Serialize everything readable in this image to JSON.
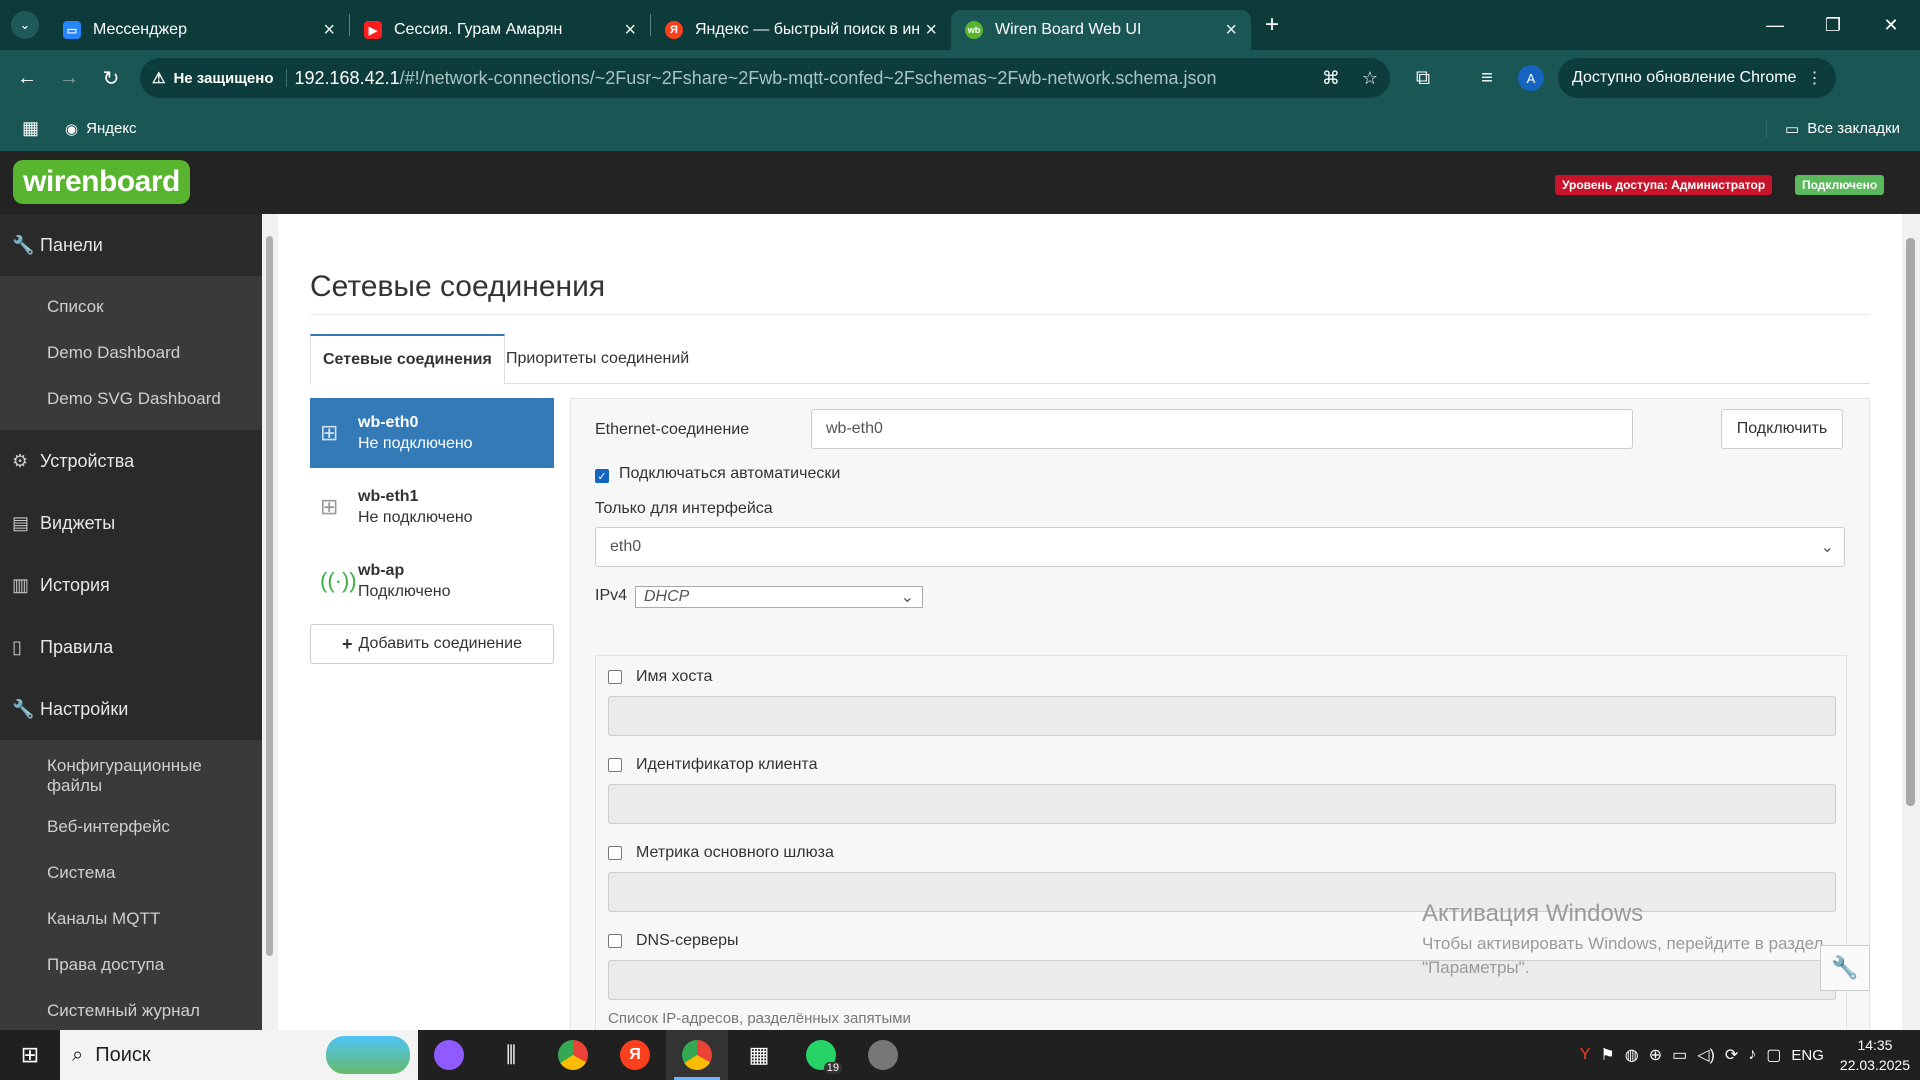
{
  "browser": {
    "tabs": [
      {
        "title": "Мессенджер",
        "favicon_color": "#2684ff",
        "favicon_glyph": "▭"
      },
      {
        "title": "Сессия. Гурам Амарян",
        "favicon_color": "#ff1f1f",
        "favicon_glyph": "▶"
      },
      {
        "title": "Яндекс — быстрый поиск в ин",
        "favicon_color": "#fc3f1d",
        "favicon_glyph": "Я"
      },
      {
        "title": "Wiren Board Web UI",
        "favicon_color": "#59b52f",
        "favicon_glyph": "wb"
      }
    ],
    "active_tab": 3,
    "security_label": "Не защищено",
    "url_host": "192.168.42.1",
    "url_path": "/#!/network-connections/~2Fusr~2Fshare~2Fwb-mqtt-confed~2Fschemas~2Fwb-network.schema.json",
    "avatar_letter": "A",
    "update_label": "Доступно обновление Chrome",
    "bookmark_yandex": "Яндекс",
    "all_bookmarks": "Все закладки"
  },
  "header": {
    "logo": "wirenboard",
    "access_badge": "Уровень доступа: Администратор",
    "access_badge_color": "#c9132a",
    "connected_badge": "Подключено",
    "connected_badge_color": "#5cb85c"
  },
  "sidebar": {
    "panels": {
      "label": "Панели",
      "items": [
        "Список",
        "Demo Dashboard",
        "Demo SVG Dashboard"
      ]
    },
    "devices": "Устройства",
    "widgets": "Виджеты",
    "history": "История",
    "rules": "Правила",
    "settings": {
      "label": "Настройки",
      "items": [
        "Конфигурационные файлы",
        "Веб-интерфейс",
        "Система",
        "Каналы MQTT",
        "Права доступа",
        "Системный журнал"
      ]
    }
  },
  "page": {
    "title": "Сетевые соединения",
    "tabs": [
      "Сетевые соединения",
      "Приоритеты соединений"
    ],
    "connections": [
      {
        "name": "wb-eth0",
        "status": "Не подключено",
        "icon": "ethernet-icon"
      },
      {
        "name": "wb-eth1",
        "status": "Не подключено",
        "icon": "ethernet-icon"
      },
      {
        "name": "wb-ap",
        "status": "Подключено",
        "icon": "wifi-ap-icon"
      }
    ],
    "add_connection": "Добавить соединение",
    "form": {
      "ethernet_label": "Ethernet-соединение",
      "ethernet_value": "wb-eth0",
      "connect_button": "Подключить",
      "autoconnect_label": "Подключаться автоматически",
      "interface_label": "Только для интерфейса",
      "interface_value": "eth0",
      "ipv4_label": "IPv4",
      "ipv4_value": "DHCP",
      "hostname_label": "Имя хоста",
      "client_id_label": "Идентификатор клиента",
      "gateway_metric_label": "Метрика основного шлюза",
      "dns_label": "DNS-серверы",
      "dns_help": "Список IP-адресов, разделённых запятыми"
    }
  },
  "watermark": {
    "title": "Активация Windows",
    "line1": "Чтобы активировать Windows, перейдите в раздел",
    "line2": "\"Параметры\"."
  },
  "taskbar": {
    "search_label": "Поиск",
    "lang": "ENG",
    "time": "14:35",
    "date": "22.03.2025",
    "whatsapp_badge": "19"
  }
}
